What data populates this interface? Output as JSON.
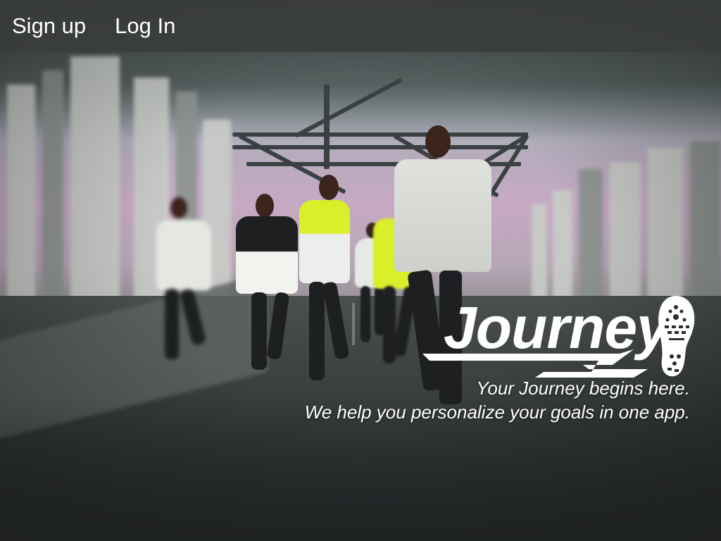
{
  "nav": {
    "signup_label": "Sign up",
    "login_label": "Log In"
  },
  "brand": {
    "name": "Journey",
    "icon": "shoe-print-icon"
  },
  "tagline": {
    "line1": "Your Journey begins here.",
    "line2": "We help you personalize your goals in one app."
  },
  "colors": {
    "topbar": "#3a3c3c",
    "text": "#ffffff",
    "accent_jacket": "#d9ef2a"
  }
}
